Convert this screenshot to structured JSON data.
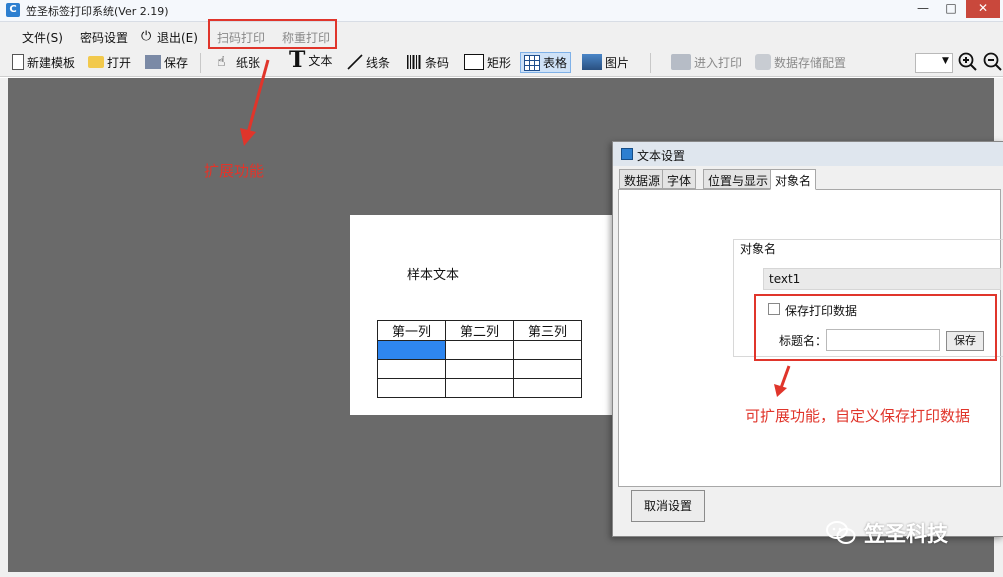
{
  "window": {
    "title": "笠圣标签打印系统(Ver 2.19)",
    "minimize": "—",
    "maximize": "□",
    "close": "✕"
  },
  "menu": {
    "file": "文件(S)",
    "password": "密码设置",
    "exit": "退出(E)",
    "scan_print": "扫码打印",
    "weigh_print": "称重打印"
  },
  "toolbar": {
    "new_template": "新建模板",
    "open": "打开",
    "save": "保存",
    "paper": "纸张",
    "text": "文本",
    "line": "线条",
    "barcode": "条码",
    "rect": "矩形",
    "table": "表格",
    "image": "图片",
    "enter_print": "进入打印",
    "data_storage": "数据存储配置"
  },
  "canvas": {
    "sample_text": "样本文本",
    "table": {
      "headers": [
        "第一列",
        "第二列",
        "第三列"
      ],
      "rows": [
        [
          "",
          "",
          ""
        ],
        [
          "",
          "",
          ""
        ],
        [
          "",
          "",
          ""
        ]
      ]
    }
  },
  "annotation": {
    "extend": "扩展功能",
    "custom": "可扩展功能，自定义保存打印数据"
  },
  "dialog": {
    "title": "文本设置",
    "tabs": [
      "数据源",
      "字体",
      "位置与显示",
      "对象名"
    ],
    "group_label": "对象名",
    "object_name": "text1",
    "save_print_data": "保存打印数据",
    "title_name_label": "标题名：",
    "title_name_value": "",
    "save_button": "保存",
    "cancel_button": "取消设置"
  },
  "watermark": {
    "text": "笠圣科技"
  },
  "colors": {
    "accent_red": "#e0352b",
    "selection_blue": "#2e86f0",
    "canvas_gray": "#6a6a6a"
  }
}
